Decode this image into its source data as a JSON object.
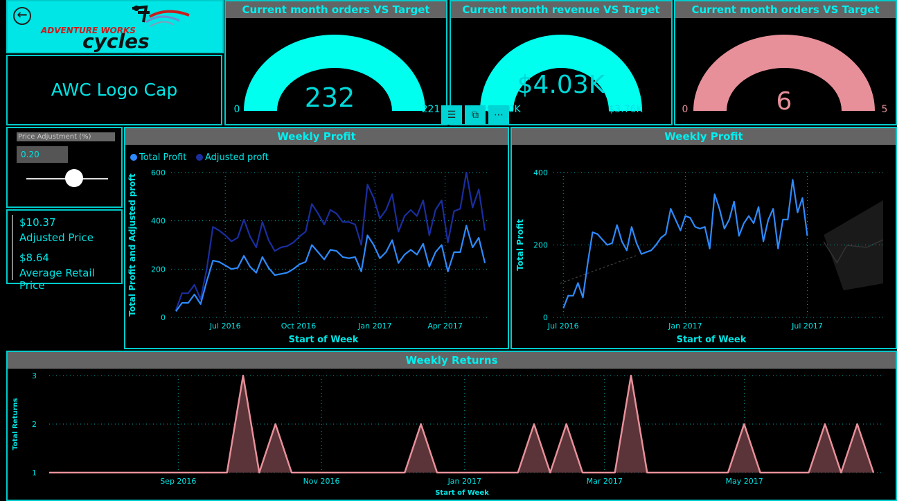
{
  "header": {
    "brand_top": "ADVENTURE WORKS",
    "brand_bottom": "cycles",
    "product_name": "AWC Logo Cap"
  },
  "gauges": [
    {
      "title": "Current month orders VS Target",
      "value_text": "232",
      "value": 232,
      "min_text": "0",
      "min": 0,
      "max_text": "221",
      "max": 221,
      "fill_color": "#00ffee"
    },
    {
      "title": "Current month revenue VS Target",
      "value_text": "$4.03K",
      "min_text": "$0.00K",
      "max_text": "$3.76K",
      "fill_color": "#00ffee"
    },
    {
      "title": "Current month orders VS Target",
      "value_text": "6",
      "value": 6,
      "min_text": "0",
      "min": 0,
      "max_text": "5",
      "max": 5,
      "fill_color": "#e8909a"
    }
  ],
  "visual_header": {
    "filter_icon": "filter-icon",
    "focus_icon": "focus-mode-icon",
    "more_icon": "more-options-icon"
  },
  "price_slider": {
    "label": "Price Adjustment (%)",
    "value": "0.20",
    "level": 0.62
  },
  "price_card": {
    "adjusted_value": "$10.37",
    "adjusted_label": "Adjusted Price",
    "avg_value": "$8.64",
    "avg_label": "Average Retail Price"
  },
  "colors": {
    "total_profit": "#2e8bff",
    "adjusted_profit": "#1a2ea0",
    "returns_line": "#e8909a",
    "returns_fill": "#5a3438",
    "accent": "#00e5e5"
  },
  "chart_data": [
    {
      "type": "line",
      "title": "Weekly Profit",
      "xlabel": "Start of Week",
      "ylabel": "Total Profit and Adjusted proft",
      "legend_position": "top-left",
      "ylim": [
        0,
        600
      ],
      "yticks": [
        "0",
        "200",
        "400",
        "600"
      ],
      "xticks": [
        "Jul 2016",
        "Oct 2016",
        "Jan 2017",
        "Apr 2017"
      ],
      "series": [
        {
          "name": "Total Profit",
          "values": [
            25,
            60,
            60,
            95,
            55,
            150,
            235,
            230,
            215,
            200,
            205,
            255,
            210,
            185,
            250,
            205,
            175,
            180,
            185,
            200,
            220,
            230,
            300,
            270,
            240,
            280,
            275,
            250,
            245,
            250,
            190,
            340,
            300,
            245,
            270,
            320,
            225,
            260,
            280,
            260,
            305,
            210,
            270,
            300,
            190,
            270,
            270,
            380,
            290,
            330,
            225
          ]
        },
        {
          "name": "Adjusted proft",
          "values": [
            30,
            100,
            100,
            135,
            75,
            200,
            375,
            360,
            340,
            315,
            330,
            405,
            335,
            290,
            395,
            320,
            275,
            290,
            295,
            310,
            335,
            355,
            470,
            430,
            385,
            445,
            430,
            395,
            395,
            385,
            300,
            550,
            495,
            410,
            445,
            510,
            355,
            420,
            445,
            420,
            485,
            340,
            445,
            485,
            310,
            440,
            450,
            600,
            455,
            530,
            360
          ]
        }
      ]
    },
    {
      "type": "line",
      "title": "Weekly Profit",
      "xlabel": "Start of Week",
      "ylabel": "Total Profit",
      "ylim": [
        0,
        400
      ],
      "yticks": [
        "0",
        "200",
        "400"
      ],
      "xticks": [
        "Jul 2016",
        "Jan 2017",
        "Jul 2017"
      ],
      "series": [
        {
          "name": "Total Profit",
          "values": [
            25,
            60,
            60,
            95,
            55,
            150,
            235,
            230,
            215,
            200,
            205,
            255,
            210,
            185,
            250,
            205,
            175,
            180,
            185,
            200,
            220,
            230,
            300,
            270,
            240,
            280,
            275,
            250,
            245,
            250,
            190,
            340,
            300,
            245,
            270,
            320,
            225,
            260,
            280,
            260,
            305,
            210,
            270,
            300,
            190,
            270,
            270,
            380,
            290,
            330,
            225
          ]
        }
      ]
    },
    {
      "type": "area",
      "title": "Weekly Returns",
      "xlabel": "Start of Week",
      "ylabel": "Total Returns",
      "ylim": [
        1,
        3
      ],
      "yticks": [
        "1",
        "2",
        "3"
      ],
      "xticks": [
        "Sep 2016",
        "Nov 2016",
        "Jan 2017",
        "Mar 2017",
        "May 2017"
      ],
      "series": [
        {
          "name": "Total Returns",
          "values": [
            1,
            1,
            1,
            1,
            1,
            1,
            1,
            1,
            1,
            1,
            1,
            1,
            3,
            1,
            2,
            1,
            1,
            1,
            1,
            1,
            1,
            1,
            1,
            2,
            1,
            1,
            1,
            1,
            1,
            1,
            2,
            1,
            2,
            1,
            1,
            1,
            3,
            1,
            1,
            1,
            1,
            1,
            1,
            2,
            1,
            1,
            1,
            1,
            2,
            1,
            2,
            1
          ]
        }
      ]
    }
  ]
}
